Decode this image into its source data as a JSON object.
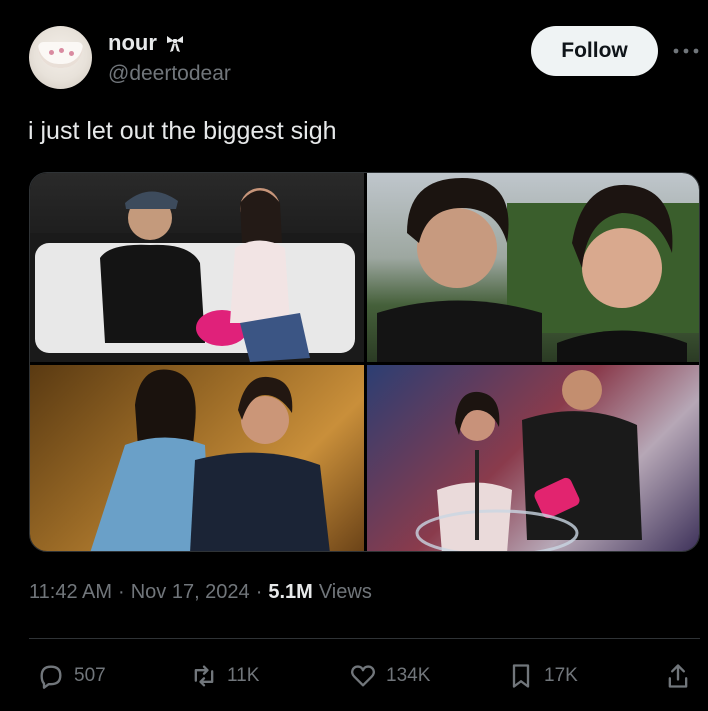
{
  "author": {
    "name": "nour",
    "handle": "@deertodear",
    "avatar_icon": "teacup-icon",
    "name_emoji_icon": "bow-icon"
  },
  "follow_button": {
    "label": "Follow"
  },
  "more_menu": {
    "icon": "more-icon"
  },
  "tweet": {
    "text": "i just let out the biggest sigh"
  },
  "media": {
    "count": 4,
    "layout": "2x2 grid"
  },
  "meta": {
    "time": "11:42 AM",
    "separator1": "·",
    "date": "Nov 17, 2024",
    "separator2": "·",
    "views_count": "5.1M",
    "views_label": "Views"
  },
  "actions": {
    "reply_count": "507",
    "retweet_count": "11K",
    "like_count": "134K",
    "bookmark_count": "17K"
  },
  "colors": {
    "background": "#000000",
    "text_primary": "#e7e9ea",
    "text_secondary": "#71767b",
    "follow_bg": "#eff3f4",
    "divider": "#2f3336"
  }
}
